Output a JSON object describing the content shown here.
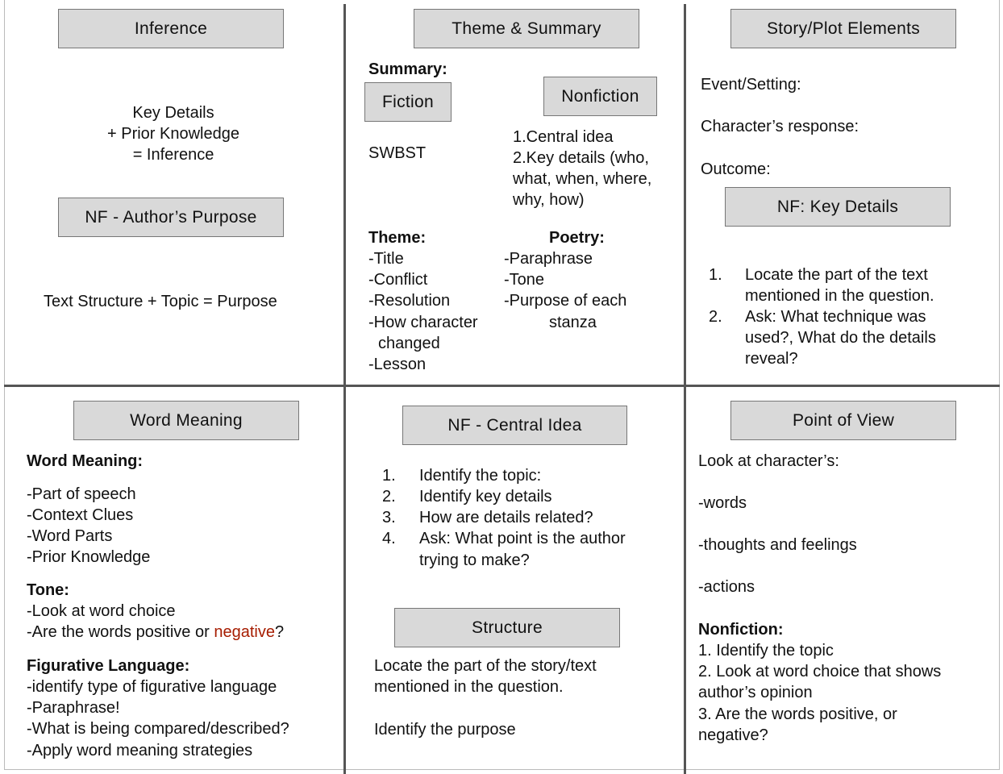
{
  "colors": {
    "header_fill": "#d9d9d9",
    "divider": "#555555",
    "highlight": "#a61c00"
  },
  "inference": {
    "header": "Inference",
    "formula": [
      "Key Details",
      "+ Prior Knowledge",
      "=  Inference"
    ],
    "purpose_header": "NF - Author’s Purpose",
    "purpose_formula": "Text Structure + Topic = Purpose"
  },
  "theme": {
    "header": "Theme & Summary",
    "summary_label": "Summary:",
    "fiction_label": "Fiction",
    "fiction_text": "SWBST",
    "nonfiction_label": "Nonfiction",
    "nonfiction_lines": [
      "1.Central idea",
      "2.Key details (who,",
      "what, when, where,",
      "why, how)"
    ],
    "theme_label": "Theme:",
    "theme_lines": [
      "-Title",
      "-Conflict",
      "-Resolution",
      "-How character",
      "changed",
      "-Lesson"
    ],
    "poetry_label": "Poetry:",
    "poetry_lines": [
      "-Paraphrase",
      "-Tone",
      "-Purpose of each",
      "stanza"
    ]
  },
  "story": {
    "header": "Story/Plot  Elements",
    "lines": [
      "Event/Setting:",
      "Character’s response:",
      "Outcome:"
    ],
    "key_details_header": "NF: Key Details",
    "steps": [
      {
        "num": "1.",
        "lines": [
          "Locate the part of the text",
          "mentioned in the question."
        ]
      },
      {
        "num": "2.",
        "lines": [
          "Ask: What technique was",
          "used?, What do the details",
          "reveal?"
        ]
      }
    ]
  },
  "word": {
    "header": "Word Meaning",
    "wm_label": "Word Meaning:",
    "wm_lines": [
      "-Part of speech",
      "-Context Clues",
      "-Word Parts",
      "-Prior Knowledge"
    ],
    "tone_label": "Tone:",
    "tone_line1": "-Look at word choice",
    "tone_line2_pre": "-Are the words positive or ",
    "tone_line2_red": "negative",
    "tone_line2_post": "?",
    "fig_label": "Figurative Language:",
    "fig_lines": [
      "-identify type of figurative language",
      "-Paraphrase!",
      "-What is being compared/described?",
      "-Apply word meaning strategies"
    ]
  },
  "central": {
    "header": "NF - Central Idea",
    "steps": [
      {
        "num": "1.",
        "lines": [
          "Identify the topic:"
        ]
      },
      {
        "num": "2.",
        "lines": [
          "Identify key details"
        ]
      },
      {
        "num": "3.",
        "lines": [
          "How are details related?"
        ]
      },
      {
        "num": "4.",
        "lines": [
          "Ask: What point is the author",
          "trying to make?"
        ]
      }
    ],
    "structure_header": "Structure",
    "structure_lines": [
      "Locate the part of the story/text",
      "mentioned in the question."
    ],
    "structure_purpose": "Identify the  purpose"
  },
  "pov": {
    "header": "Point of View",
    "lines": [
      "Look at character’s:",
      "-words",
      "-thoughts and feelings",
      "-actions"
    ],
    "nf_label": "Nonfiction:",
    "nf_lines": [
      "1. Identify the topic",
      "2. Look at word choice that shows",
      "author’s opinion",
      "3. Are the words positive, or",
      "negative?"
    ]
  }
}
